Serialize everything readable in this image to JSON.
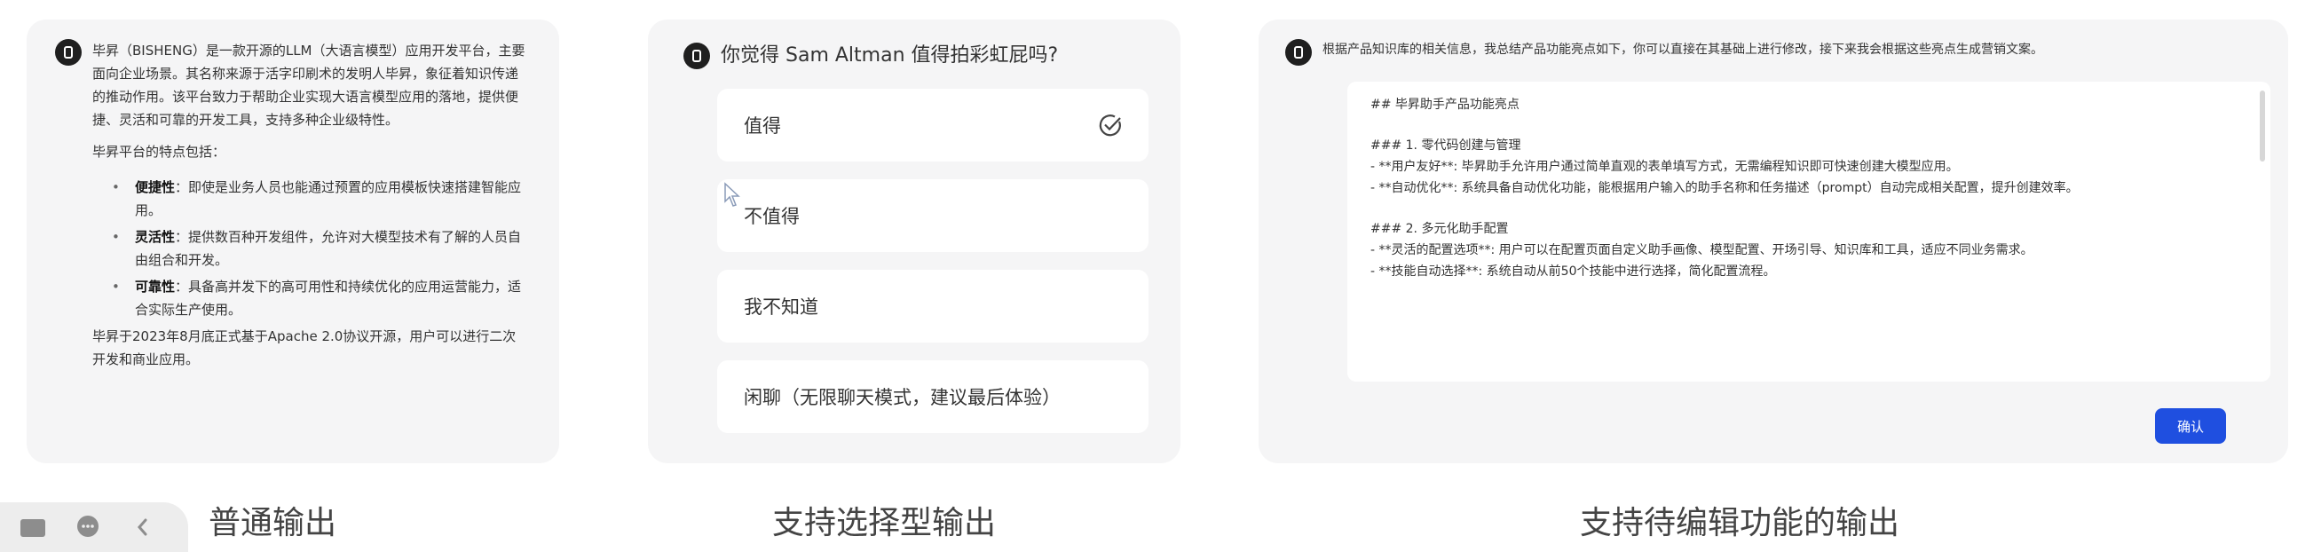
{
  "plain": {
    "paragraph1": "毕昇（BISHENG）是一款开源的LLM（大语言模型）应用开发平台，主要面向企业场景。其名称来源于活字印刷术的发明人毕昇，象征着知识传递的推动作用。该平台致力于帮助企业实现大语言模型应用的落地，提供便捷、灵活和可靠的开发工具，支持多种企业级特性。",
    "paragraph2": "毕昇平台的特点包括：",
    "bullets": [
      {
        "term": "便捷性",
        "text": "：即使是业务人员也能通过预置的应用模板快速搭建智能应用。"
      },
      {
        "term": "灵活性",
        "text": "：提供数百种开发组件，允许对大模型技术有了解的人员自由组合和开发。"
      },
      {
        "term": "可靠性",
        "text": "：具备高并发下的高可用性和持续优化的应用运营能力，适合实际生产使用。"
      }
    ],
    "paragraph3": "毕昇于2023年8月底正式基于Apache 2.0协议开源，用户可以进行二次开发和商业应用。"
  },
  "choice": {
    "question": "你觉得 Sam Altman 值得拍彩虹屁吗?",
    "options": [
      "值得",
      "不值得",
      "我不知道",
      "闲聊（无限聊天模式，建议最后体验）"
    ],
    "selected_index": 0
  },
  "edit": {
    "intro": "根据产品知识库的相关信息，我总结产品功能亮点如下，你可以直接在其基础上进行修改，接下来我会根据这些亮点生成营销文案。",
    "lines": [
      "## 毕昇助手产品功能亮点",
      "",
      "### 1. 零代码创建与管理",
      "- **用户友好**: 毕昇助手允许用户通过简单直观的表单填写方式，无需编程知识即可快速创建大模型应用。",
      "- **自动优化**: 系统具备自动优化功能，能根据用户输入的助手名称和任务描述（prompt）自动完成相关配置，提升创建效率。",
      "",
      "### 2. 多元化助手配置",
      "- **灵活的配置选项**: 用户可以在配置页面自定义助手画像、模型配置、开场引导、知识库和工具，适应不同业务需求。",
      "- **技能自动选择**: 系统自动从前50个技能中进行选择，简化配置流程。"
    ],
    "confirm_label": "确认"
  },
  "captions": [
    "普通输出",
    "支持选择型输出",
    "支持待编辑功能的输出"
  ],
  "colors": {
    "accent": "#1f4fe0",
    "card_bg": "#f5f5f6"
  }
}
